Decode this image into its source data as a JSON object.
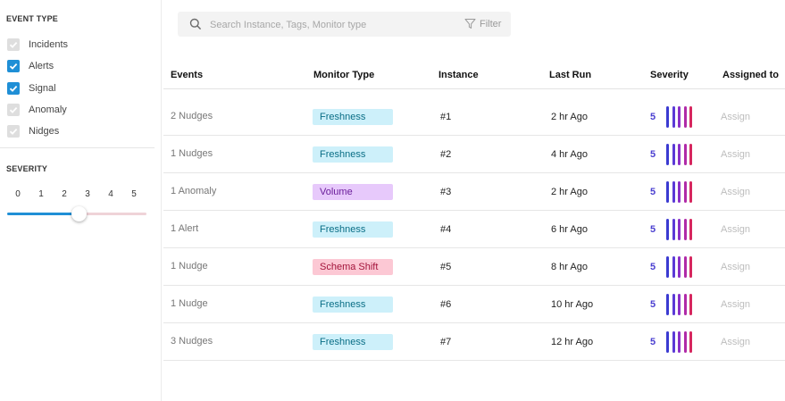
{
  "sidebar": {
    "event_type_title": "EVENT TYPE",
    "event_types": [
      {
        "label": "Incidents",
        "checked": false
      },
      {
        "label": "Alerts",
        "checked": true
      },
      {
        "label": "Signal",
        "checked": true
      },
      {
        "label": "Anomaly",
        "checked": false
      },
      {
        "label": "Nidges",
        "checked": false
      }
    ],
    "severity_title": "SEVERITY",
    "severity_scale": [
      "0",
      "1",
      "2",
      "3",
      "4",
      "5"
    ],
    "severity_value": 3
  },
  "search": {
    "placeholder": "Search Instance, Tags, Monitor type",
    "value": "",
    "filter_label": "Filter"
  },
  "table": {
    "headers": {
      "events": "Events",
      "monitor_type": "Monitor Type",
      "instance": "Instance",
      "last_run": "Last Run",
      "severity": "Severity",
      "assigned_to": "Assigned to"
    },
    "rows": [
      {
        "events": "2 Nudges",
        "monitor_type": "Freshness",
        "instance": "#1",
        "last_run": "2 hr Ago",
        "severity": "5",
        "assign": "Assign"
      },
      {
        "events": "1 Nudges",
        "monitor_type": "Freshness",
        "instance": "#2",
        "last_run": "4 hr Ago",
        "severity": "5",
        "assign": "Assign"
      },
      {
        "events": "1 Anomaly",
        "monitor_type": "Volume",
        "instance": "#3",
        "last_run": "2 hr Ago",
        "severity": "5",
        "assign": "Assign"
      },
      {
        "events": "1 Alert",
        "monitor_type": "Freshness",
        "instance": "#4",
        "last_run": "6 hr Ago",
        "severity": "5",
        "assign": "Assign"
      },
      {
        "events": "1 Nudge",
        "monitor_type": "Schema Shift",
        "instance": "#5",
        "last_run": "8 hr Ago",
        "severity": "5",
        "assign": "Assign"
      },
      {
        "events": "1 Nudge",
        "monitor_type": "Freshness",
        "instance": "#6",
        "last_run": "10 hr Ago",
        "severity": "5",
        "assign": "Assign"
      },
      {
        "events": "3 Nudges",
        "monitor_type": "Freshness",
        "instance": "#7",
        "last_run": "12 hr Ago",
        "severity": "5",
        "assign": "Assign"
      }
    ]
  },
  "colors": {
    "accent": "#1f8fd6",
    "freshness_bg": "#cdf0fa",
    "freshness_text": "#0a6e86",
    "volume_bg": "#e7c9fb",
    "volume_text": "#6a1d9a",
    "schema_shift_bg": "#fcc8d4",
    "schema_shift_text": "#a3143b",
    "severity_bars": [
      "#3b3bd1",
      "#5b3ad6",
      "#8a2fc8",
      "#b02aa8",
      "#d6265e"
    ]
  }
}
